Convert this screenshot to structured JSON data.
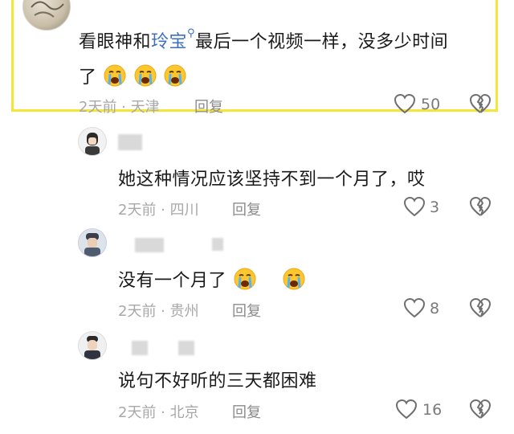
{
  "comments": [
    {
      "text_before": "看眼神和",
      "link": "玲宝",
      "text_after": "最后一个视频一样，没多少时间",
      "line2": "了",
      "meta": "2天前 · 天津",
      "reply": "回复",
      "likes": "50",
      "emoji_count": 3
    },
    {
      "text": "她这种情况应该坚持不到一个月了，哎",
      "meta": "2天前 · 四川",
      "reply": "回复",
      "likes": "3"
    },
    {
      "text": "没有一个月了",
      "meta": "2天前 · 贵州",
      "reply": "回复",
      "likes": "8",
      "emoji_count": 2
    },
    {
      "text": "说句不好听的三天都困难",
      "meta": "2天前 · 北京",
      "reply": "回复",
      "likes": "16"
    }
  ],
  "colors": {
    "highlight": "#f3e636",
    "link": "#3e6fbf",
    "meta": "#a8a8a8"
  }
}
